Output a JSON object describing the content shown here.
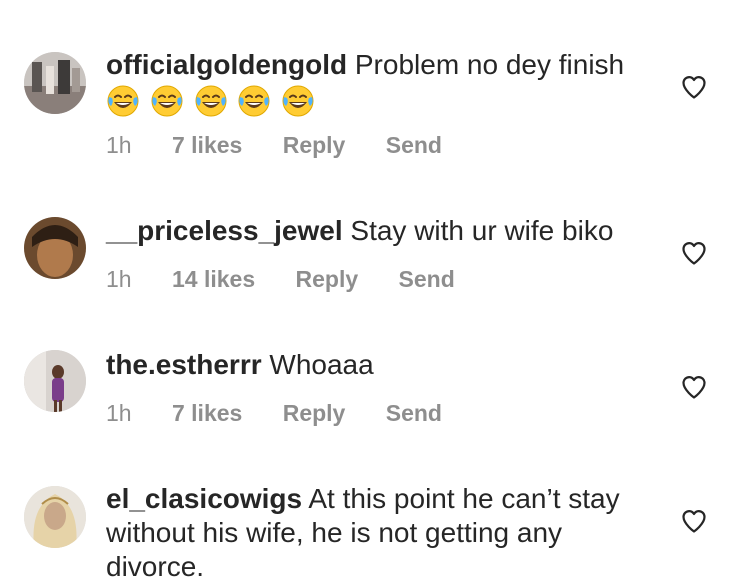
{
  "comments": [
    {
      "username": "officialgoldengold",
      "text": "Problem no dey finish",
      "emojis": [
        "face-with-tears-of-joy",
        "face-with-tears-of-joy",
        "face-with-tears-of-joy",
        "face-with-tears-of-joy",
        "face-with-tears-of-joy"
      ],
      "time": "1h",
      "likes": "7 likes",
      "reply": "Reply",
      "send": "Send"
    },
    {
      "username": "__priceless_jewel",
      "text": "Stay with ur wife biko",
      "time": "1h",
      "likes": "14 likes",
      "reply": "Reply",
      "send": "Send"
    },
    {
      "username": "the.estherrr",
      "text": "Whoaaa",
      "time": "1h",
      "likes": "7 likes",
      "reply": "Reply",
      "send": "Send"
    },
    {
      "username": "el_clasicowigs",
      "text": "At this point he can’t stay without his wife, he is not getting any divorce."
    }
  ],
  "icons": {
    "like": "heart-outline-icon"
  },
  "colors": {
    "text": "#262626",
    "meta": "#8e8e8e",
    "heart": "#262626",
    "emoji": "#ffcc33"
  }
}
